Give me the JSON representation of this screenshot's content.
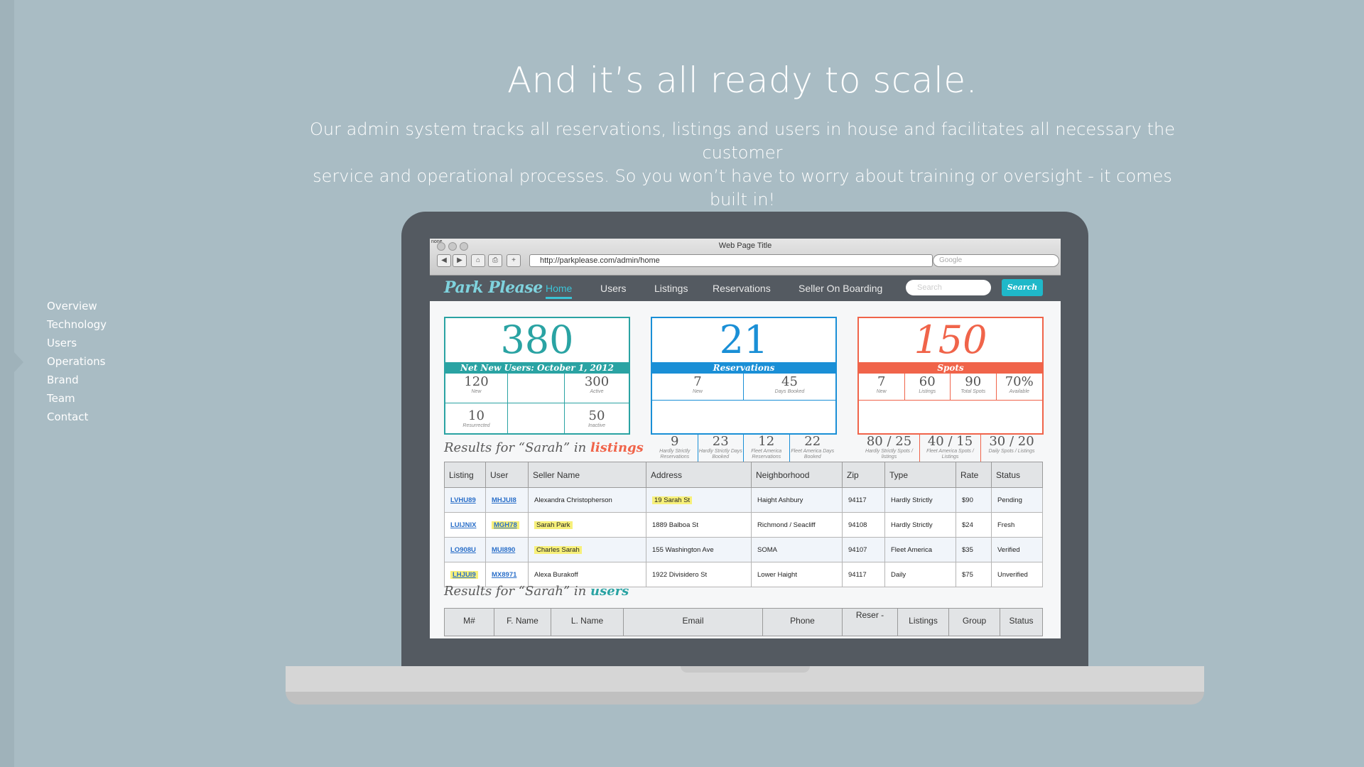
{
  "headline": "And it’s all ready to scale.",
  "subtext_line1": "Our admin system tracks all reservations, listings and users in house and facilitates all necessary the customer",
  "subtext_line2": "service and operational processes. So you won’t have to worry about training or oversight - it comes built in!",
  "side_nav": [
    "Overview",
    "Technology",
    "Users",
    "Operations",
    "Brand",
    "Team",
    "Contact"
  ],
  "browser": {
    "window_title": "Web Page Title",
    "window_label": "none",
    "url": "http://parkplease.com/admin/home",
    "search_placeholder": "Google"
  },
  "app": {
    "logo": "Park Please",
    "tabs": [
      "Home",
      "Users",
      "Listings",
      "Reservations",
      "Seller On Boarding"
    ],
    "active_tab": "Home",
    "search_placeholder": "Search",
    "search_button": "Search"
  },
  "colors": {
    "teal": "#2aa3a3",
    "blue": "#1a8fd6",
    "coral": "#f0644a"
  },
  "cards": [
    {
      "value": "380",
      "label": "Net New Users: October 1, 2012",
      "cells": [
        {
          "n": "120",
          "l": "New"
        },
        {
          "n": "",
          "l": ""
        },
        {
          "n": "300",
          "l": "Active"
        },
        {
          "n": "10",
          "l": "Resurrected"
        },
        {
          "n": "",
          "l": ""
        },
        {
          "n": "50",
          "l": "Inactive"
        }
      ]
    },
    {
      "value": "21",
      "label": "Reservations",
      "top": [
        {
          "n": "7",
          "l": "New"
        },
        {
          "n": "45",
          "l": "Days Booked"
        }
      ],
      "bottom": [
        {
          "n": "9",
          "l": "Hardly Strictly Reservations"
        },
        {
          "n": "23",
          "l": "Hardly Strictly Days Booked"
        },
        {
          "n": "12",
          "l": "Fleet America Reservations"
        },
        {
          "n": "22",
          "l": "Fleet America Days Booked"
        }
      ]
    },
    {
      "value": "150",
      "label": "Spots",
      "top": [
        {
          "n": "7",
          "l": "New"
        },
        {
          "n": "60",
          "l": "Listings"
        },
        {
          "n": "90",
          "l": "Total Spots"
        },
        {
          "n": "70%",
          "l": "Available"
        }
      ],
      "bottom": [
        {
          "n": "80 / 25",
          "l": "Hardly Strictly Spots / listings"
        },
        {
          "n": "40 / 15",
          "l": "Fleet America Spots / Listings"
        },
        {
          "n": "30 / 20",
          "l": "Daily Spots / Listings"
        }
      ]
    }
  ],
  "listings_heading": {
    "prefix": "Results for “Sarah” in ",
    "keyword": "listings"
  },
  "listings_columns": [
    "Listing",
    "User",
    "Seller Name",
    "Address",
    "Neighborhood",
    "Zip",
    "Type",
    "Rate",
    "Status"
  ],
  "listings_rows": [
    [
      "LVHU89",
      "MHJUI8",
      "Alexandra Christopherson",
      "19 Sarah St",
      "Haight Ashbury",
      "94117",
      "Hardly Strictly",
      "$90",
      "Pending"
    ],
    [
      "LUIJNIX",
      "MGH78",
      "Sarah Park",
      "1889 Balboa St",
      "Richmond / Seacliff",
      "94108",
      "Hardly Strictly",
      "$24",
      "Fresh"
    ],
    [
      "LO908U",
      "MUI890",
      "Charles Sarah",
      "155 Washington Ave",
      "SOMA",
      "94107",
      "Fleet America",
      "$35",
      "Verified"
    ],
    [
      "LHJUI9",
      "MX8971",
      "Alexa Burakoff",
      "1922 Divisidero St",
      "Lower Haight",
      "94117",
      "Daily",
      "$75",
      "Unverified"
    ]
  ],
  "users_heading": {
    "prefix": "Results for “Sarah” in ",
    "keyword": "users"
  },
  "users_columns": [
    "M#",
    "F. Name",
    "L. Name",
    "Email",
    "Phone",
    "Reser -",
    "Listings",
    "Group",
    "Status"
  ]
}
